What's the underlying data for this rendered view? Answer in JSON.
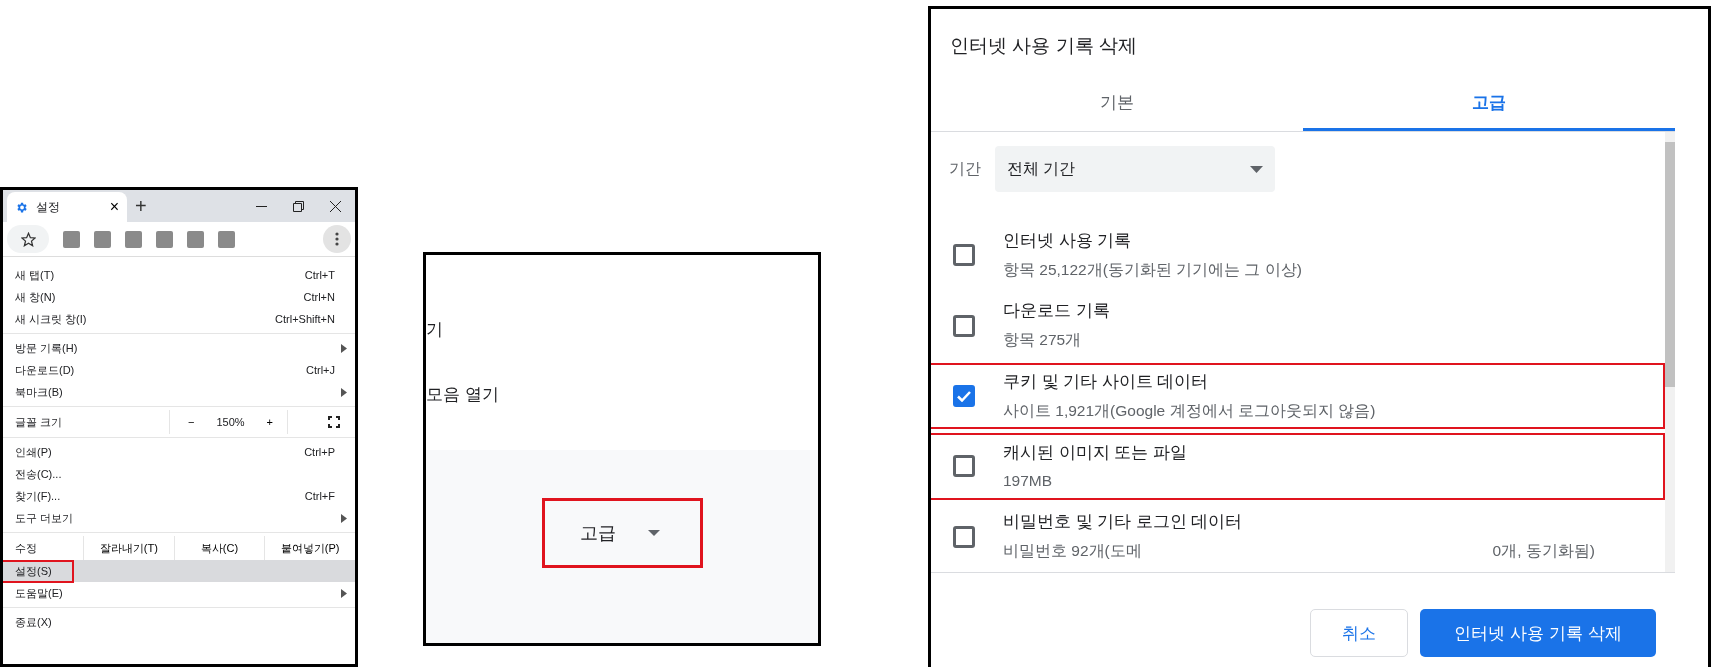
{
  "browser_menu_panel": {
    "tab": {
      "title": "설정",
      "close": "×"
    },
    "new_tab": "+",
    "menu": [
      [
        {
          "kind": "item",
          "label": "새 탭(T)",
          "shortcut": "Ctrl+T",
          "submenu": false,
          "selected": false,
          "highlighted": false
        },
        {
          "kind": "item",
          "label": "새 창(N)",
          "shortcut": "Ctrl+N",
          "submenu": false,
          "selected": false,
          "highlighted": false
        },
        {
          "kind": "item",
          "label": "새 시크릿 창(I)",
          "shortcut": "Ctrl+Shift+N",
          "submenu": false,
          "selected": false,
          "highlighted": false
        }
      ],
      [
        {
          "kind": "item",
          "label": "방문 기록(H)",
          "submenu": true,
          "selected": false,
          "highlighted": false
        },
        {
          "kind": "item",
          "label": "다운로드(D)",
          "shortcut": "Ctrl+J",
          "submenu": false,
          "selected": false,
          "highlighted": false
        },
        {
          "kind": "item",
          "label": "북마크(B)",
          "submenu": true,
          "selected": false,
          "highlighted": false
        }
      ],
      [
        {
          "kind": "zoom",
          "label": "글꼴 크기",
          "minus": "−",
          "value": "150%",
          "plus": "+"
        }
      ],
      [
        {
          "kind": "item",
          "label": "인쇄(P)",
          "shortcut": "Ctrl+P",
          "submenu": false,
          "selected": false,
          "highlighted": false
        },
        {
          "kind": "item",
          "label": "전송(C)...",
          "submenu": false,
          "selected": false,
          "highlighted": false
        },
        {
          "kind": "item",
          "label": "찾기(F)...",
          "shortcut": "Ctrl+F",
          "submenu": false,
          "selected": false,
          "highlighted": false
        },
        {
          "kind": "item",
          "label": "도구 더보기",
          "submenu": true,
          "selected": false,
          "highlighted": false
        }
      ],
      [
        {
          "kind": "edit",
          "label": "수정",
          "actions": [
            "잘라내기(T)",
            "복사(C)",
            "붙여넣기(P)"
          ]
        },
        {
          "kind": "item",
          "label": "설정(S)",
          "submenu": false,
          "selected": true,
          "highlighted": true
        },
        {
          "kind": "item",
          "label": "도움말(E)",
          "submenu": true,
          "selected": false,
          "highlighted": false
        }
      ],
      [
        {
          "kind": "item",
          "label": "종료(X)",
          "submenu": false,
          "selected": false,
          "highlighted": false
        }
      ]
    ]
  },
  "settings_page_panel": {
    "text_fragments": [
      "기",
      "모음 열기"
    ],
    "advanced_button": {
      "label": "고급",
      "highlighted": true
    }
  },
  "clear_data_dialog": {
    "title": "인터넷 사용 기록 삭제",
    "tabs": [
      {
        "label": "기본",
        "selected": false
      },
      {
        "label": "고급",
        "selected": true
      }
    ],
    "time_range": {
      "label": "기간",
      "value": "전체 기간"
    },
    "options": [
      {
        "title": "인터넷 사용 기록",
        "detail": "항목 25,122개(동기화된 기기에는 그 이상)",
        "checked": false,
        "highlighted": false
      },
      {
        "title": "다운로드 기록",
        "detail": "항목 275개",
        "checked": false,
        "highlighted": false
      },
      {
        "title": "쿠키 및 기타 사이트 데이터",
        "detail": "사이트 1,921개(Google 계정에서 로그아웃되지 않음)",
        "checked": true,
        "highlighted": true
      },
      {
        "title": "캐시된 이미지 또는 파일",
        "detail": "197MB",
        "checked": false,
        "highlighted": true
      },
      {
        "title": "비밀번호 및 기타 로그인 데이터",
        "detail": "비밀번호 92개(도메",
        "detail_2": "0개, 동기화됨)",
        "checked": false,
        "highlighted": false
      }
    ],
    "buttons": [
      {
        "label": "취소",
        "kind": "secondary"
      },
      {
        "label": "인터넷 사용 기록 삭제",
        "kind": "primary"
      }
    ]
  }
}
